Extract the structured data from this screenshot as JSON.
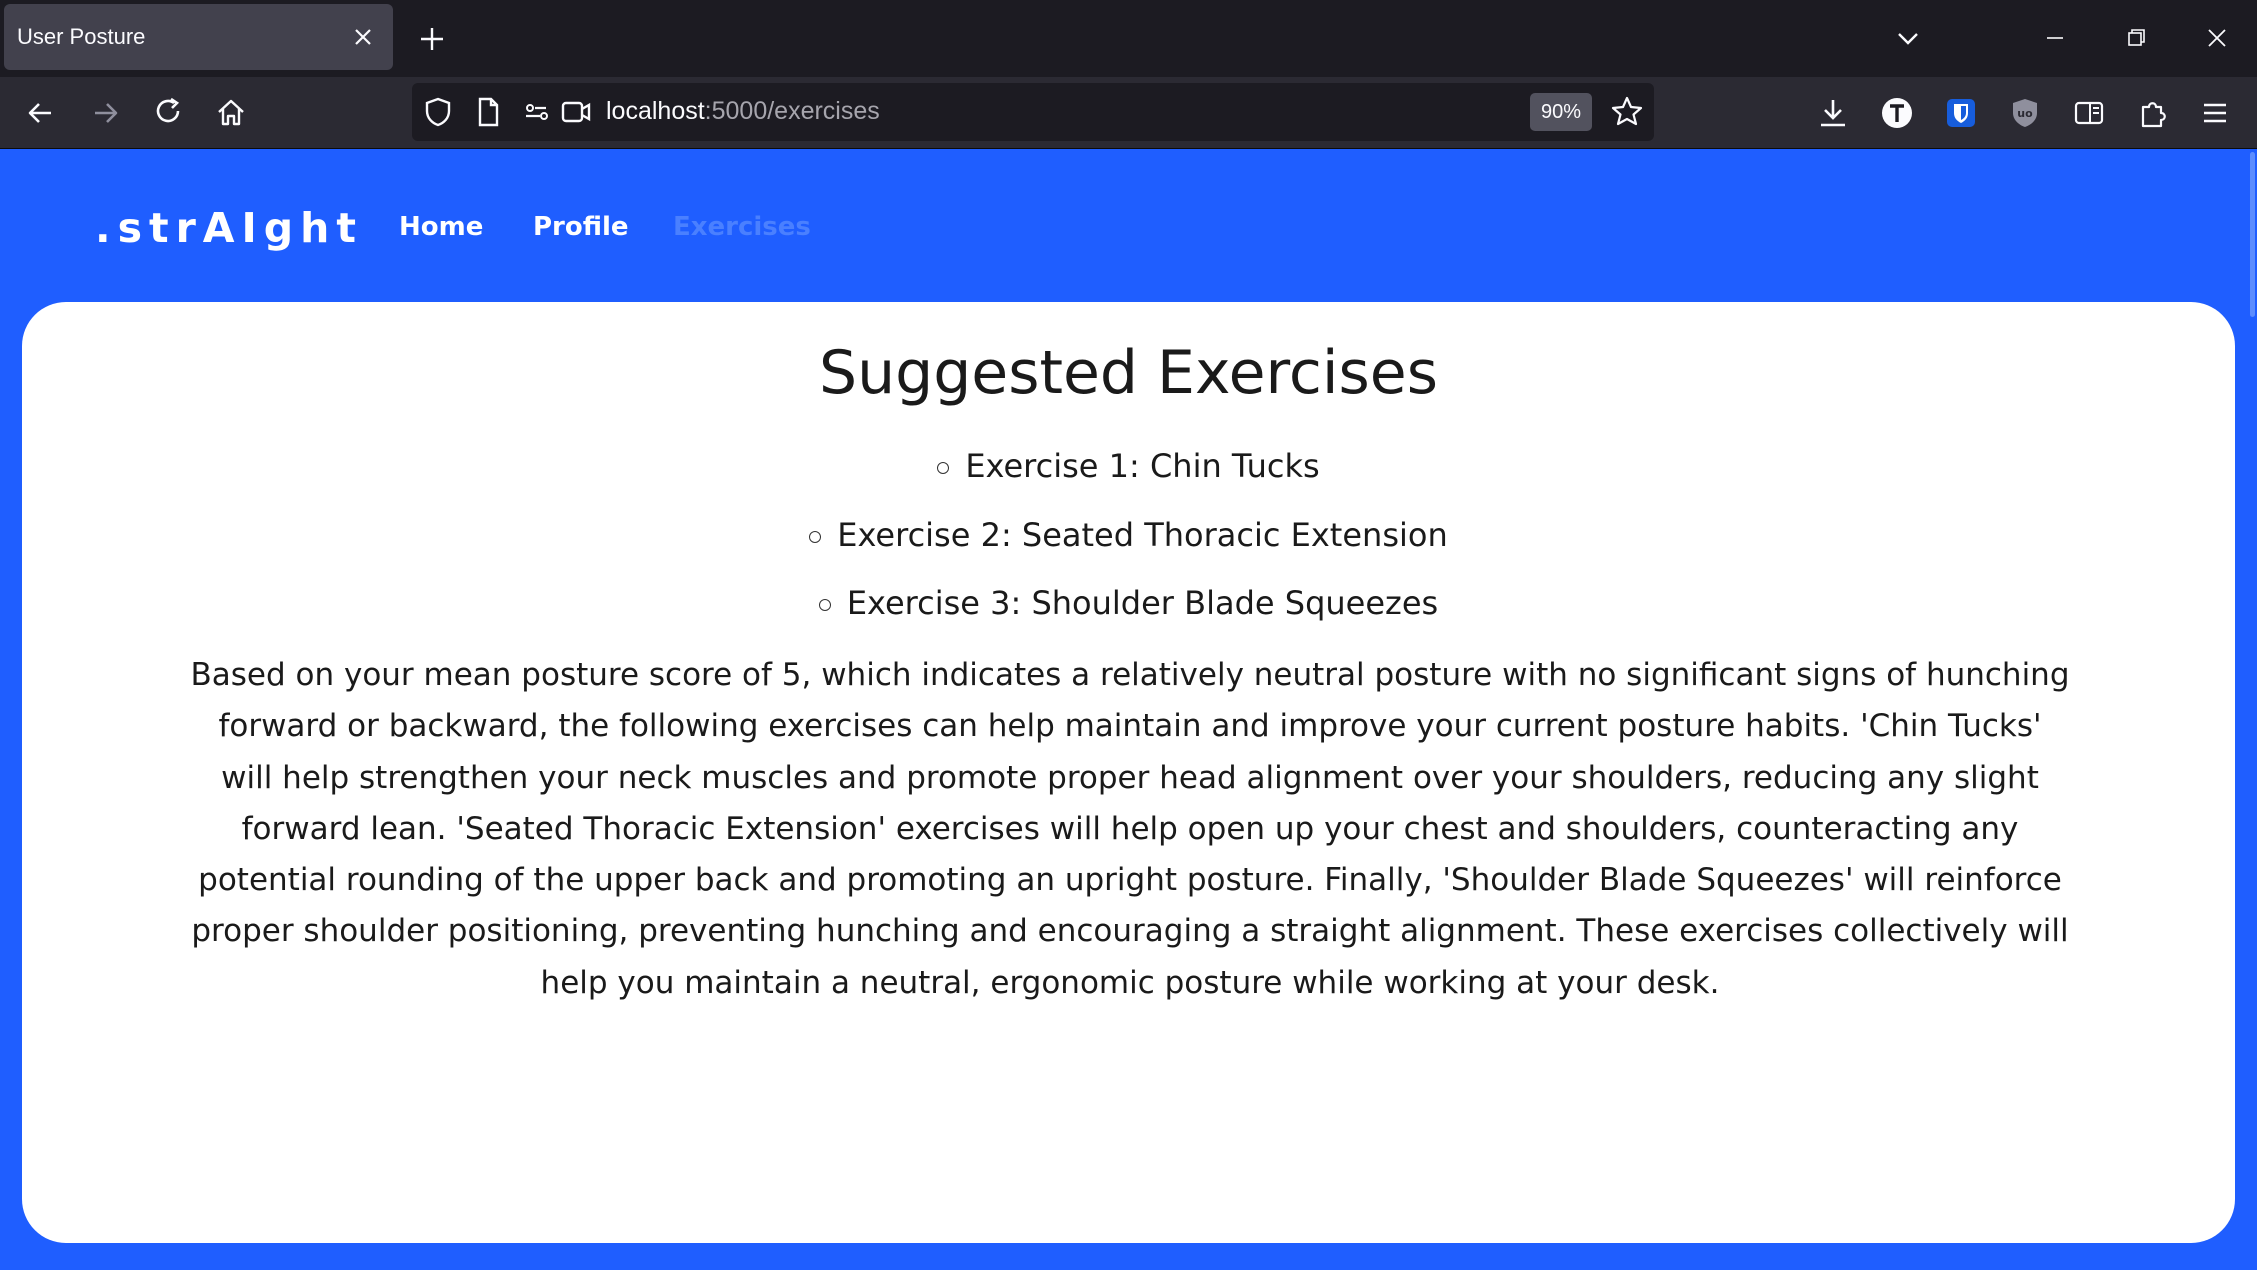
{
  "browser": {
    "tab_title": "User Posture",
    "url_host": "localhost",
    "url_path": ":5000/exercises",
    "zoom": "90%"
  },
  "site": {
    "brand": ".strAIght",
    "nav": {
      "home": "Home",
      "profile": "Profile",
      "exercises": "Exercises"
    }
  },
  "main": {
    "title": "Suggested Exercises",
    "exercises": [
      "Exercise 1: Chin Tucks",
      "Exercise 2: Seated Thoracic Extension",
      "Exercise 3: Shoulder Blade Squeezes"
    ],
    "description": "Based on your mean posture score of 5, which indicates a relatively neutral posture with no significant signs of hunching forward or backward, the following exercises can help maintain and improve your current posture habits. 'Chin Tucks' will help strengthen your neck muscles and promote proper head alignment over your shoulders, reducing any slight forward lean. 'Seated Thoracic Extension' exercises will help open up your chest and shoulders, counteracting any potential rounding of the upper back and promoting an upright posture. Finally, 'Shoulder Blade Squeezes' will reinforce proper shoulder positioning, preventing hunching and encouraging a straight alignment. These exercises collectively will help you maintain a neutral, ergonomic posture while working at your desk."
  },
  "colors": {
    "accent": "#1f5eff",
    "chrome_dark": "#1c1b22",
    "chrome_toolbar": "#2b2a33",
    "card": "#ffffff"
  }
}
